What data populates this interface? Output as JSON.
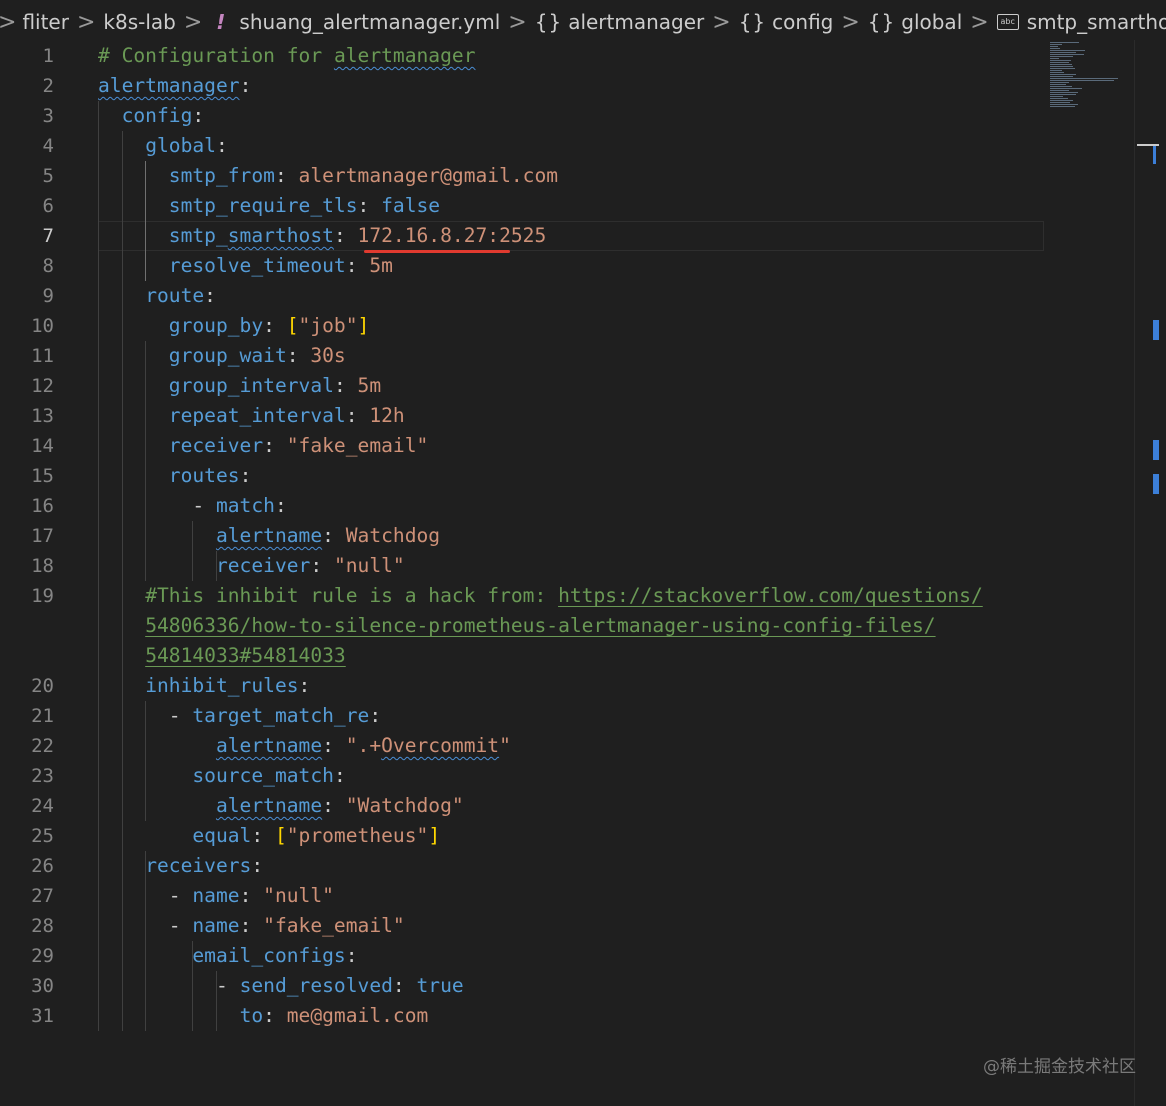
{
  "breadcrumb": {
    "items": [
      "fliter",
      "k8s-lab",
      "shuang_alertmanager.yml",
      "alertmanager",
      "config",
      "global",
      "smtp_smarthost"
    ],
    "bang": "!",
    "braces": "{}",
    "abc": "abc",
    "sep": ">"
  },
  "editor": {
    "active_line": 7,
    "lines": [
      {
        "n": "1",
        "segs": [
          [
            "cmt",
            "# Configuration for "
          ],
          [
            "cmt sq",
            "alertmanager"
          ]
        ]
      },
      {
        "n": "2",
        "segs": [
          [
            "key sq",
            "alertmanager"
          ],
          [
            "punct",
            ":"
          ]
        ]
      },
      {
        "n": "3",
        "segs": [
          [
            "punct",
            "  "
          ],
          [
            "key",
            "config"
          ],
          [
            "punct",
            ":"
          ]
        ]
      },
      {
        "n": "4",
        "segs": [
          [
            "punct",
            "    "
          ],
          [
            "key",
            "global"
          ],
          [
            "punct",
            ":"
          ]
        ]
      },
      {
        "n": "5",
        "segs": [
          [
            "punct",
            "      "
          ],
          [
            "key",
            "smtp_from"
          ],
          [
            "punct",
            ": "
          ],
          [
            "str",
            "alertmanager@gmail.com"
          ]
        ]
      },
      {
        "n": "6",
        "segs": [
          [
            "punct",
            "      "
          ],
          [
            "key",
            "smtp_require_tls"
          ],
          [
            "punct",
            ": "
          ],
          [
            "kw",
            "false"
          ]
        ]
      },
      {
        "n": "7",
        "segs": [
          [
            "punct",
            "      "
          ],
          [
            "key",
            "smtp_"
          ],
          [
            "key sq",
            "smarthost"
          ],
          [
            "punct",
            ": "
          ],
          [
            "str",
            "172.16.8.27:2525"
          ]
        ]
      },
      {
        "n": "8",
        "segs": [
          [
            "punct",
            "      "
          ],
          [
            "key",
            "resolve_timeout"
          ],
          [
            "punct",
            ": "
          ],
          [
            "str",
            "5m"
          ]
        ]
      },
      {
        "n": "9",
        "segs": [
          [
            "punct",
            "    "
          ],
          [
            "key",
            "route"
          ],
          [
            "punct",
            ":"
          ]
        ]
      },
      {
        "n": "10",
        "segs": [
          [
            "punct",
            "      "
          ],
          [
            "key",
            "group_by"
          ],
          [
            "punct",
            ": "
          ],
          [
            "bracket",
            "["
          ],
          [
            "str",
            "\"job\""
          ],
          [
            "bracket",
            "]"
          ]
        ]
      },
      {
        "n": "11",
        "segs": [
          [
            "punct",
            "      "
          ],
          [
            "key",
            "group_wait"
          ],
          [
            "punct",
            ": "
          ],
          [
            "str",
            "30s"
          ]
        ]
      },
      {
        "n": "12",
        "segs": [
          [
            "punct",
            "      "
          ],
          [
            "key",
            "group_interval"
          ],
          [
            "punct",
            ": "
          ],
          [
            "str",
            "5m"
          ]
        ]
      },
      {
        "n": "13",
        "segs": [
          [
            "punct",
            "      "
          ],
          [
            "key",
            "repeat_interval"
          ],
          [
            "punct",
            ": "
          ],
          [
            "str",
            "12h"
          ]
        ]
      },
      {
        "n": "14",
        "segs": [
          [
            "punct",
            "      "
          ],
          [
            "key",
            "receiver"
          ],
          [
            "punct",
            ": "
          ],
          [
            "str",
            "\"fake_email\""
          ]
        ]
      },
      {
        "n": "15",
        "segs": [
          [
            "punct",
            "      "
          ],
          [
            "key",
            "routes"
          ],
          [
            "punct",
            ":"
          ]
        ]
      },
      {
        "n": "16",
        "segs": [
          [
            "punct",
            "        - "
          ],
          [
            "key",
            "match"
          ],
          [
            "punct",
            ":"
          ]
        ]
      },
      {
        "n": "17",
        "segs": [
          [
            "punct",
            "          "
          ],
          [
            "key sq",
            "alertname"
          ],
          [
            "punct",
            ": "
          ],
          [
            "str",
            "Watchdog"
          ]
        ]
      },
      {
        "n": "18",
        "segs": [
          [
            "punct",
            "          "
          ],
          [
            "key",
            "receiver"
          ],
          [
            "punct",
            ": "
          ],
          [
            "str",
            "\"null\""
          ]
        ]
      },
      {
        "n": "19",
        "segs": [
          [
            "punct",
            "    "
          ],
          [
            "cmt",
            "#This inhibit rule is a hack from: "
          ],
          [
            "cmt link",
            "https://stackoverflow.com/questions/"
          ]
        ]
      },
      {
        "n": "",
        "segs": [
          [
            "punct",
            "    "
          ],
          [
            "cmt link",
            "54806336/how-to-silence-prometheus-alertmanager-using-config-files/"
          ]
        ]
      },
      {
        "n": "",
        "segs": [
          [
            "punct",
            "    "
          ],
          [
            "cmt link",
            "54814033#54814033"
          ]
        ]
      },
      {
        "n": "20",
        "segs": [
          [
            "punct",
            "    "
          ],
          [
            "key",
            "inhibit_rules"
          ],
          [
            "punct",
            ":"
          ]
        ]
      },
      {
        "n": "21",
        "segs": [
          [
            "punct",
            "      - "
          ],
          [
            "key",
            "target_match_re"
          ],
          [
            "punct",
            ":"
          ]
        ]
      },
      {
        "n": "22",
        "segs": [
          [
            "punct",
            "          "
          ],
          [
            "key sq",
            "alertname"
          ],
          [
            "punct",
            ": "
          ],
          [
            "str",
            "\".+"
          ],
          [
            "str sq",
            "Overcommit"
          ],
          [
            "str",
            "\""
          ]
        ]
      },
      {
        "n": "23",
        "segs": [
          [
            "punct",
            "        "
          ],
          [
            "key",
            "source_match"
          ],
          [
            "punct",
            ":"
          ]
        ]
      },
      {
        "n": "24",
        "segs": [
          [
            "punct",
            "          "
          ],
          [
            "key sq",
            "alertname"
          ],
          [
            "punct",
            ": "
          ],
          [
            "str",
            "\"Watchdog\""
          ]
        ]
      },
      {
        "n": "25",
        "segs": [
          [
            "punct",
            "        "
          ],
          [
            "key",
            "equal"
          ],
          [
            "punct",
            ": "
          ],
          [
            "bracket",
            "["
          ],
          [
            "str",
            "\"prometheus\""
          ],
          [
            "bracket",
            "]"
          ]
        ]
      },
      {
        "n": "26",
        "segs": [
          [
            "punct",
            "    "
          ],
          [
            "key",
            "receivers"
          ],
          [
            "punct",
            ":"
          ]
        ]
      },
      {
        "n": "27",
        "segs": [
          [
            "punct",
            "      - "
          ],
          [
            "key",
            "name"
          ],
          [
            "punct",
            ": "
          ],
          [
            "str",
            "\"null\""
          ]
        ]
      },
      {
        "n": "28",
        "segs": [
          [
            "punct",
            "      - "
          ],
          [
            "key",
            "name"
          ],
          [
            "punct",
            ": "
          ],
          [
            "str",
            "\"fake_email\""
          ]
        ]
      },
      {
        "n": "29",
        "segs": [
          [
            "punct",
            "        "
          ],
          [
            "key",
            "email_configs"
          ],
          [
            "punct",
            ":"
          ]
        ]
      },
      {
        "n": "30",
        "segs": [
          [
            "punct",
            "          - "
          ],
          [
            "key",
            "send_resolved"
          ],
          [
            "punct",
            ": "
          ],
          [
            "kw",
            "true"
          ]
        ]
      },
      {
        "n": "31",
        "segs": [
          [
            "punct",
            "            "
          ],
          [
            "key",
            "to"
          ],
          [
            "punct",
            ": "
          ],
          [
            "str",
            "me@gmail.com"
          ]
        ]
      }
    ]
  },
  "colors": {
    "background": "#1f1f1f",
    "key": "#569cd6",
    "string": "#ce9178",
    "comment": "#6a9955",
    "bracket": "#ffd700",
    "annotation_underline": "#e03a2f",
    "scroll_marker": "#3c7fd8"
  },
  "watermark": "@稀土掘金技术社区"
}
